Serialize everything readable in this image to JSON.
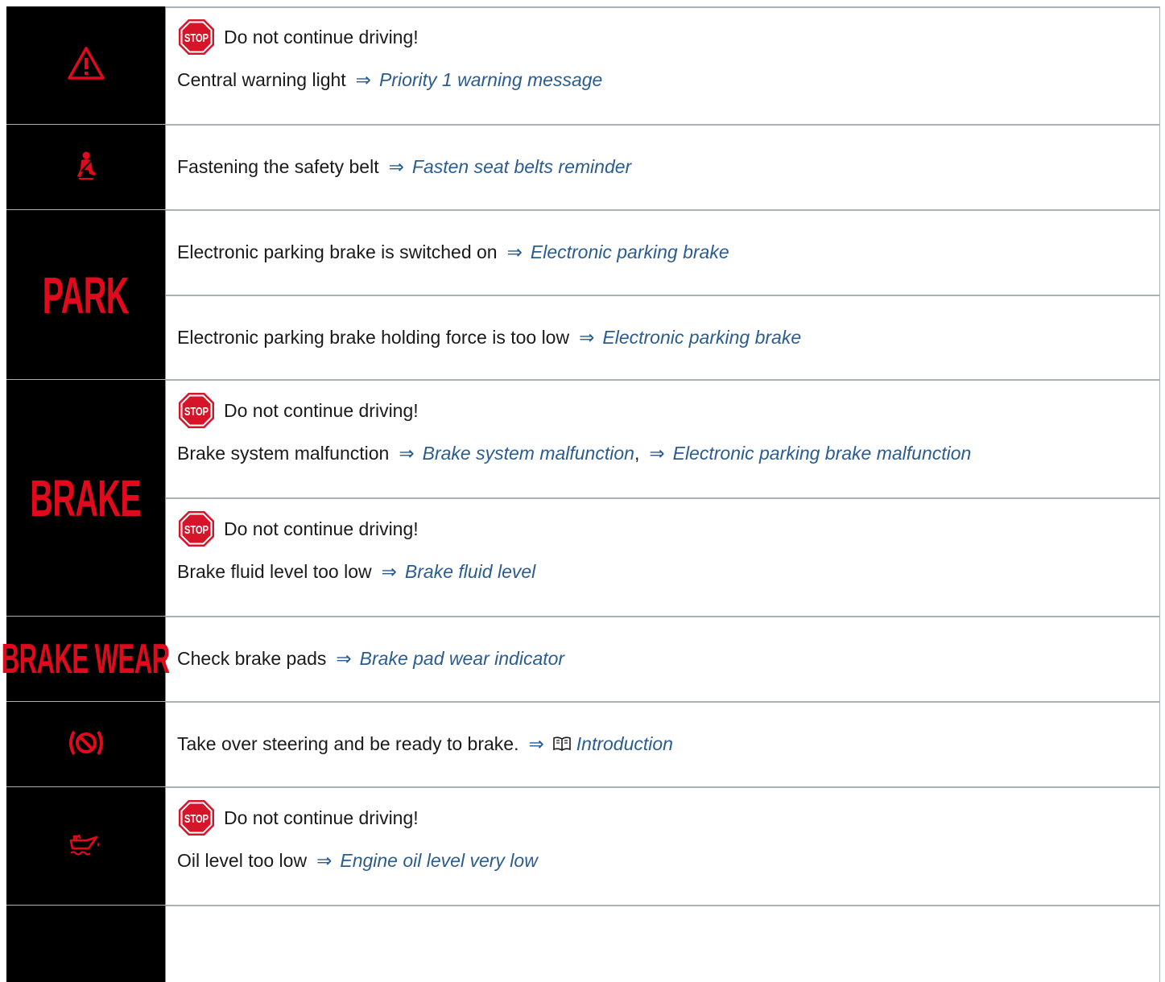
{
  "rows": [
    {
      "icon": "central-warning-icon",
      "items": [
        {
          "stop": true,
          "stop_text": "Do not continue driving!",
          "text": "Central warning light",
          "links": [
            {
              "arrow": "⇒",
              "label": "Priority 1 warning message"
            }
          ]
        }
      ]
    },
    {
      "icon": "seat-belt-icon",
      "items": [
        {
          "stop": false,
          "text": "Fastening the safety belt",
          "links": [
            {
              "arrow": "⇒",
              "label": "Fasten seat belts reminder"
            }
          ]
        }
      ]
    },
    {
      "icon": "park-icon",
      "icon_text": "PARK",
      "items": [
        {
          "stop": false,
          "text": "Electronic parking brake is switched on",
          "links": [
            {
              "arrow": "⇒",
              "label": "Electronic parking brake"
            }
          ]
        },
        {
          "stop": false,
          "text": "Electronic parking brake holding force is too low",
          "links": [
            {
              "arrow": "⇒",
              "label": "Electronic parking brake"
            }
          ]
        }
      ]
    },
    {
      "icon": "brake-icon",
      "icon_text": "BRAKE",
      "items": [
        {
          "stop": true,
          "stop_text": "Do not continue driving!",
          "text": "Brake system malfunction",
          "links": [
            {
              "arrow": "⇒",
              "label": "Brake system malfunction"
            },
            {
              "arrow": "⇒",
              "label": "Electronic parking brake malfunction"
            }
          ]
        },
        {
          "stop": true,
          "stop_text": "Do not continue driving!",
          "text": "Brake fluid level too low",
          "links": [
            {
              "arrow": "⇒",
              "label": "Brake fluid level"
            }
          ]
        }
      ]
    },
    {
      "icon": "brake-wear-icon",
      "icon_text": "BRAKE WEAR",
      "items": [
        {
          "stop": false,
          "text": "Check brake pads",
          "links": [
            {
              "arrow": "⇒",
              "label": "Brake pad wear indicator"
            }
          ]
        }
      ]
    },
    {
      "icon": "steering-brake-icon",
      "items": [
        {
          "stop": false,
          "text": "Take over steering and be ready to brake.",
          "links": [
            {
              "arrow": "⇒",
              "book": true,
              "label": "Introduction"
            }
          ]
        }
      ]
    },
    {
      "icon": "oil-can-icon",
      "items": [
        {
          "stop": true,
          "stop_text": "Do not continue driving!",
          "text": "Oil level too low",
          "links": [
            {
              "arrow": "⇒",
              "label": "Engine oil level very low"
            }
          ]
        }
      ]
    },
    {
      "icon": "",
      "items": []
    }
  ],
  "stop_sign_text": "STOP",
  "colors": {
    "link": "#2a5c91",
    "icon_red": "#e10a1c",
    "stop_red": "#d7152a",
    "grid": "#a9b3b6"
  }
}
